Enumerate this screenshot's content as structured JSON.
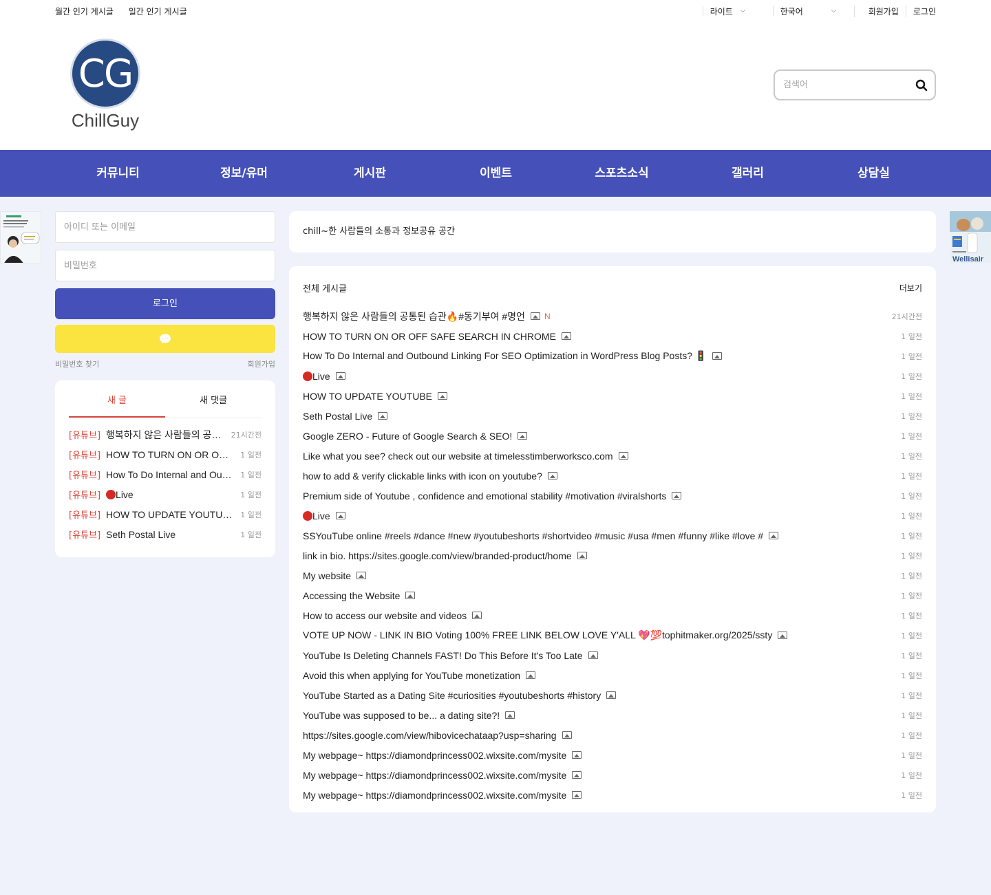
{
  "topbar": {
    "monthly": "월간 인기 게시글",
    "daily": "일간 인기 게시글",
    "theme": "라이트",
    "language": "한국어",
    "signup": "회원가입",
    "login": "로그인"
  },
  "logo": {
    "initials": "CG",
    "name": "ChillGuy"
  },
  "search": {
    "placeholder": "검색어"
  },
  "nav": [
    "커뮤니티",
    "정보/유머",
    "게시판",
    "이벤트",
    "스포츠소식",
    "갤러리",
    "상담실"
  ],
  "login_form": {
    "id_placeholder": "아이디 또는 이메일",
    "pw_placeholder": "비밀번호",
    "login_button": "로그인",
    "find_password": "비밀번호 찾기",
    "signup": "회원가입"
  },
  "recent": {
    "tab_posts": "새 글",
    "tab_comments": "새 댓글",
    "items": [
      {
        "cat": "[유튜브]",
        "title": "행복하지 않은 사람들의 공통된 습관🔥#동기부여 #명언",
        "time": "21시간전",
        "dot": false
      },
      {
        "cat": "[유튜브]",
        "title": "HOW TO TURN ON OR OFF SAFE SEARCH IN CHROME",
        "time": "1 일전",
        "dot": false
      },
      {
        "cat": "[유튜브]",
        "title": "How To Do Internal and Outbound Linking",
        "time": "1 일전",
        "dot": false
      },
      {
        "cat": "[유튜브]",
        "title": "Live",
        "time": "1 일전",
        "dot": true
      },
      {
        "cat": "[유튜브]",
        "title": "HOW TO UPDATE YOUTUBE",
        "time": "1 일전",
        "dot": false
      },
      {
        "cat": "[유튜브]",
        "title": "Seth Postal Live",
        "time": "1 일전",
        "dot": false
      }
    ]
  },
  "intro": "chill~한 사람들의 소통과 정보공유 공간",
  "board": {
    "title": "전체 게시글",
    "more": "더보기",
    "posts": [
      {
        "title": "행복하지 않은 사람들의 공통된 습관🔥#동기부여 #명언",
        "time": "21시간전",
        "new": "N",
        "dot": false
      },
      {
        "title": "HOW TO TURN ON OR OFF SAFE SEARCH IN CHROME",
        "time": "1 일전",
        "new": "",
        "dot": false
      },
      {
        "title": "How To Do Internal and Outbound Linking For SEO Optimization in WordPress Blog Posts? 🚦",
        "time": "1 일전",
        "new": "",
        "dot": false
      },
      {
        "title": "Live",
        "time": "1 일전",
        "new": "",
        "dot": true
      },
      {
        "title": "HOW TO UPDATE YOUTUBE",
        "time": "1 일전",
        "new": "",
        "dot": false
      },
      {
        "title": "Seth Postal Live",
        "time": "1 일전",
        "new": "",
        "dot": false
      },
      {
        "title": "Google ZERO - Future of Google Search & SEO!",
        "time": "1 일전",
        "new": "",
        "dot": false
      },
      {
        "title": "Like what you see? check out our website at timelesstimberworksco.com",
        "time": "1 일전",
        "new": "",
        "dot": false
      },
      {
        "title": "how to add & verify clickable links with icon on youtube?",
        "time": "1 일전",
        "new": "",
        "dot": false
      },
      {
        "title": "Premium side of Youtube , confidence and emotional stability #motivation #viralshorts",
        "time": "1 일전",
        "new": "",
        "dot": false
      },
      {
        "title": "Live",
        "time": "1 일전",
        "new": "",
        "dot": true
      },
      {
        "title": "SSYouTube online #reels #dance #new #youtubeshorts #shortvideo #music #usa #men #funny #like #love #",
        "time": "1 일전",
        "new": "",
        "dot": false
      },
      {
        "title": "link in bio. https://sites.google.com/view/branded-product/home",
        "time": "1 일전",
        "new": "",
        "dot": false
      },
      {
        "title": "My website",
        "time": "1 일전",
        "new": "",
        "dot": false
      },
      {
        "title": "Accessing the Website",
        "time": "1 일전",
        "new": "",
        "dot": false
      },
      {
        "title": "How to access our website and videos",
        "time": "1 일전",
        "new": "",
        "dot": false
      },
      {
        "title": "VOTE UP NOW - LINK IN BIO Voting 100% FREE LINK BELOW LOVE Y'ALL 💖💯tophitmaker.org/2025/ssty",
        "time": "1 일전",
        "new": "",
        "dot": false
      },
      {
        "title": "YouTube Is Deleting Channels FAST! Do This Before It's Too Late",
        "time": "1 일전",
        "new": "",
        "dot": false
      },
      {
        "title": "Avoid this when applying for YouTube monetization",
        "time": "1 일전",
        "new": "",
        "dot": false
      },
      {
        "title": "YouTube Started as a Dating Site #curiosities #youtubeshorts #history",
        "time": "1 일전",
        "new": "",
        "dot": false
      },
      {
        "title": "YouTube was supposed to be... a dating site?!",
        "time": "1 일전",
        "new": "",
        "dot": false
      },
      {
        "title": "https://sites.google.com/view/hibovicechataap?usp=sharing",
        "time": "1 일전",
        "new": "",
        "dot": false
      },
      {
        "title": "My webpage~ https://diamondprincess002.wixsite.com/mysite",
        "time": "1 일전",
        "new": "",
        "dot": false
      },
      {
        "title": "My webpage~ https://diamondprincess002.wixsite.com/mysite",
        "time": "1 일전",
        "new": "",
        "dot": false
      },
      {
        "title": "My webpage~ https://diamondprincess002.wixsite.com/mysite",
        "time": "1 일전",
        "new": "",
        "dot": false
      }
    ]
  },
  "ads": {
    "right_brand": "Wellisair"
  },
  "colors": {
    "primary": "#4551b8",
    "accent": "#d9453e",
    "kakao": "#fbe340",
    "logo": "#284a82"
  }
}
